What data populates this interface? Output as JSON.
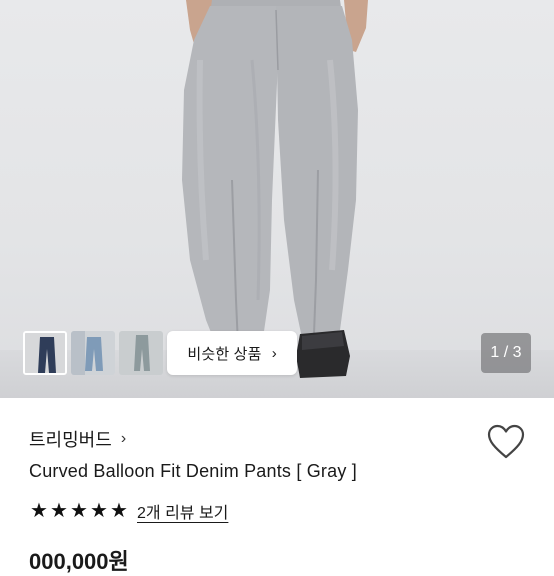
{
  "gallery": {
    "counter": "1 / 3",
    "similar_label": "비슷한 상품",
    "similar_chevron": "›",
    "thumbnails": [
      "dark-denim-thumb",
      "light-denim-thumb",
      "gray-denim-thumb"
    ]
  },
  "product": {
    "brand": "트리밍버드",
    "brand_chevron": "›",
    "title": "Curved Balloon Fit Denim Pants [ Gray ]",
    "rating_stars": 5,
    "stars": [
      "★",
      "★",
      "★",
      "★",
      "★"
    ],
    "review_link": "2개 리뷰 보기",
    "price": "000,000원"
  },
  "colors": {
    "denim_gray": "#b5b7bb",
    "text": "#1a1a1a"
  }
}
